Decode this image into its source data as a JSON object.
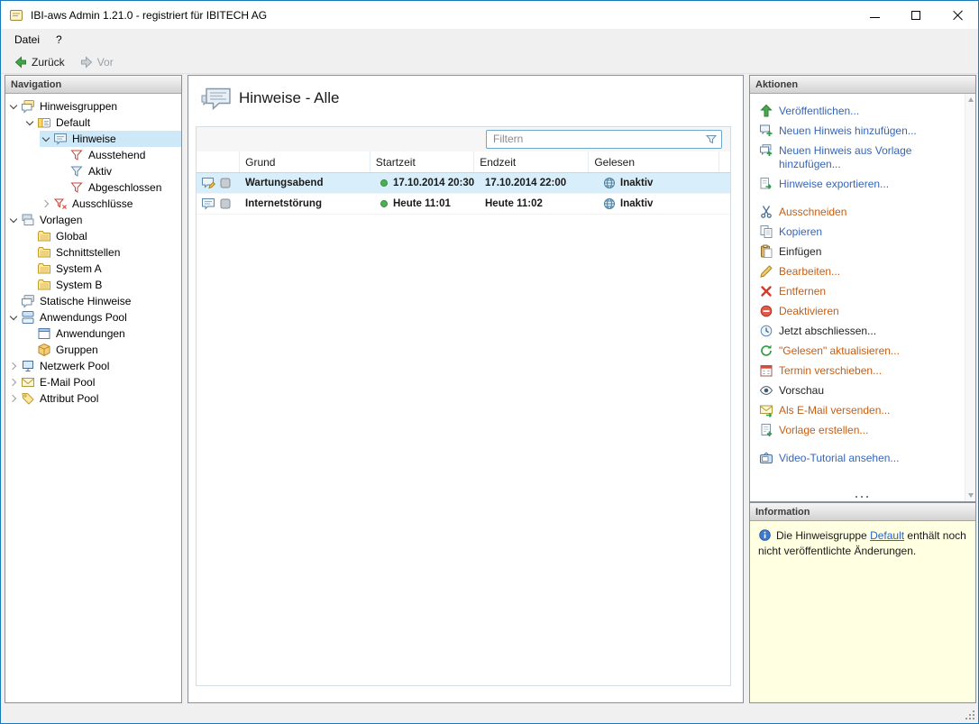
{
  "window": {
    "title": "IBI-aws Admin 1.21.0 - registriert für IBITECH AG",
    "app_icon": "app-icon"
  },
  "menubar": {
    "items": [
      {
        "label": "Datei"
      },
      {
        "label": "?"
      }
    ]
  },
  "toolbar": {
    "back_label": "Zurück",
    "back_icon": "back-arrow-icon",
    "forward_label": "Vor",
    "forward_icon": "forward-arrow-icon"
  },
  "navigation": {
    "header": "Navigation",
    "tree": [
      {
        "label": "Hinweisgruppen",
        "depth": 0,
        "expand": "open",
        "icon": "hint-groups-icon",
        "selected": false
      },
      {
        "label": "Default",
        "depth": 1,
        "expand": "open",
        "icon": "hint-group-icon",
        "selected": false
      },
      {
        "label": "Hinweise",
        "depth": 2,
        "expand": "open",
        "icon": "hints-icon",
        "selected": true
      },
      {
        "label": "Ausstehend",
        "depth": 3,
        "expand": "none",
        "icon": "filter-red-icon",
        "selected": false
      },
      {
        "label": "Aktiv",
        "depth": 3,
        "expand": "none",
        "icon": "filter-blue-icon",
        "selected": false
      },
      {
        "label": "Abgeschlossen",
        "depth": 3,
        "expand": "none",
        "icon": "filter-red-icon",
        "selected": false
      },
      {
        "label": "Ausschlüsse",
        "depth": 2,
        "expand": "closed",
        "icon": "exclusions-icon",
        "selected": false
      },
      {
        "label": "Vorlagen",
        "depth": 0,
        "expand": "open",
        "icon": "templates-icon",
        "selected": false
      },
      {
        "label": "Global",
        "depth": 1,
        "expand": "none",
        "icon": "folder-icon",
        "selected": false
      },
      {
        "label": "Schnittstellen",
        "depth": 1,
        "expand": "none",
        "icon": "folder-icon",
        "selected": false
      },
      {
        "label": "System A",
        "depth": 1,
        "expand": "none",
        "icon": "folder-icon",
        "selected": false
      },
      {
        "label": "System B",
        "depth": 1,
        "expand": "none",
        "icon": "folder-icon",
        "selected": false
      },
      {
        "label": "Statische Hinweise",
        "depth": 0,
        "expand": "none",
        "icon": "static-hints-icon",
        "selected": false
      },
      {
        "label": "Anwendungs Pool",
        "depth": 0,
        "expand": "open",
        "icon": "app-pool-icon",
        "selected": false
      },
      {
        "label": "Anwendungen",
        "depth": 1,
        "expand": "none",
        "icon": "applications-icon",
        "selected": false
      },
      {
        "label": "Gruppen",
        "depth": 1,
        "expand": "none",
        "icon": "groups-icon",
        "selected": false
      },
      {
        "label": "Netzwerk Pool",
        "depth": 0,
        "expand": "closed",
        "icon": "network-pool-icon",
        "selected": false
      },
      {
        "label": "E-Mail Pool",
        "depth": 0,
        "expand": "closed",
        "icon": "email-pool-icon",
        "selected": false
      },
      {
        "label": "Attribut Pool",
        "depth": 0,
        "expand": "closed",
        "icon": "attribute-pool-icon",
        "selected": false
      }
    ]
  },
  "main": {
    "title": "Hinweise - Alle",
    "title_icon": "page-hints-icon",
    "filter_placeholder": "Filtern",
    "filter_icon": "filter-funnel-icon",
    "table": {
      "columns": [
        "",
        "Grund",
        "Startzeit",
        "Endzeit",
        "Gelesen"
      ],
      "rows": [
        {
          "type_icon": "hint-edited-icon",
          "state_icon": "square-gray-icon",
          "grund": "Wartungsabend",
          "start_icon": "green-dot-icon",
          "startzeit": "17.10.2014 20:30",
          "endzeit": "17.10.2014 22:00",
          "gelesen_icon": "globe-icon",
          "gelesen": "Inaktiv",
          "selected": true
        },
        {
          "type_icon": "hint-icon",
          "state_icon": "square-gray-icon",
          "grund": "Internetstörung",
          "start_icon": "green-dot-icon",
          "startzeit": "Heute 11:01",
          "endzeit": "Heute 11:02",
          "gelesen_icon": "globe-icon",
          "gelesen": "Inaktiv",
          "selected": false
        }
      ]
    }
  },
  "actions": {
    "header": "Aktionen",
    "items": [
      {
        "label": "Veröffentlichen...",
        "icon": "publish-icon",
        "color": "blue"
      },
      {
        "label": "Neuen Hinweis hinzufügen...",
        "icon": "add-hint-icon",
        "color": "blue"
      },
      {
        "label": "Neuen Hinweis aus Vorlage hinzufügen...",
        "icon": "add-from-template-icon",
        "color": "blue"
      },
      {
        "label": "Hinweise exportieren...",
        "icon": "export-icon",
        "color": "blue"
      },
      {
        "label": "Ausschneiden",
        "icon": "cut-icon",
        "color": "orange",
        "gap_before": true
      },
      {
        "label": "Kopieren",
        "icon": "copy-icon",
        "color": "blue"
      },
      {
        "label": "Einfügen",
        "icon": "paste-icon",
        "color": "black"
      },
      {
        "label": "Bearbeiten...",
        "icon": "edit-icon",
        "color": "orange"
      },
      {
        "label": "Entfernen",
        "icon": "remove-icon",
        "color": "orange"
      },
      {
        "label": "Deaktivieren",
        "icon": "deactivate-icon",
        "color": "orange"
      },
      {
        "label": "Jetzt abschliessen...",
        "icon": "complete-icon",
        "color": "black"
      },
      {
        "label": "\"Gelesen\" aktualisieren...",
        "icon": "refresh-icon",
        "color": "orange"
      },
      {
        "label": "Termin verschieben...",
        "icon": "reschedule-icon",
        "color": "orange"
      },
      {
        "label": "Vorschau",
        "icon": "preview-icon",
        "color": "black"
      },
      {
        "label": "Als E-Mail versenden...",
        "icon": "send-email-icon",
        "color": "orange"
      },
      {
        "label": "Vorlage erstellen...",
        "icon": "create-template-icon",
        "color": "orange"
      },
      {
        "label": "Video-Tutorial ansehen...",
        "icon": "video-icon",
        "color": "blue",
        "gap_before": true
      }
    ]
  },
  "information": {
    "header": "Information",
    "icon": "info-icon",
    "text_before": "Die Hinweisgruppe ",
    "link_label": "Default",
    "text_after": " enthält noch nicht veröffentlichte Änderungen."
  },
  "colors": {
    "link_blue": "#3566b8",
    "link_orange": "#c55e14",
    "link_black": "#222222",
    "selection": "#cde8f7",
    "row_selection": "#d8eefb",
    "info_bg": "#ffffe1",
    "window_border": "#1879bd"
  }
}
